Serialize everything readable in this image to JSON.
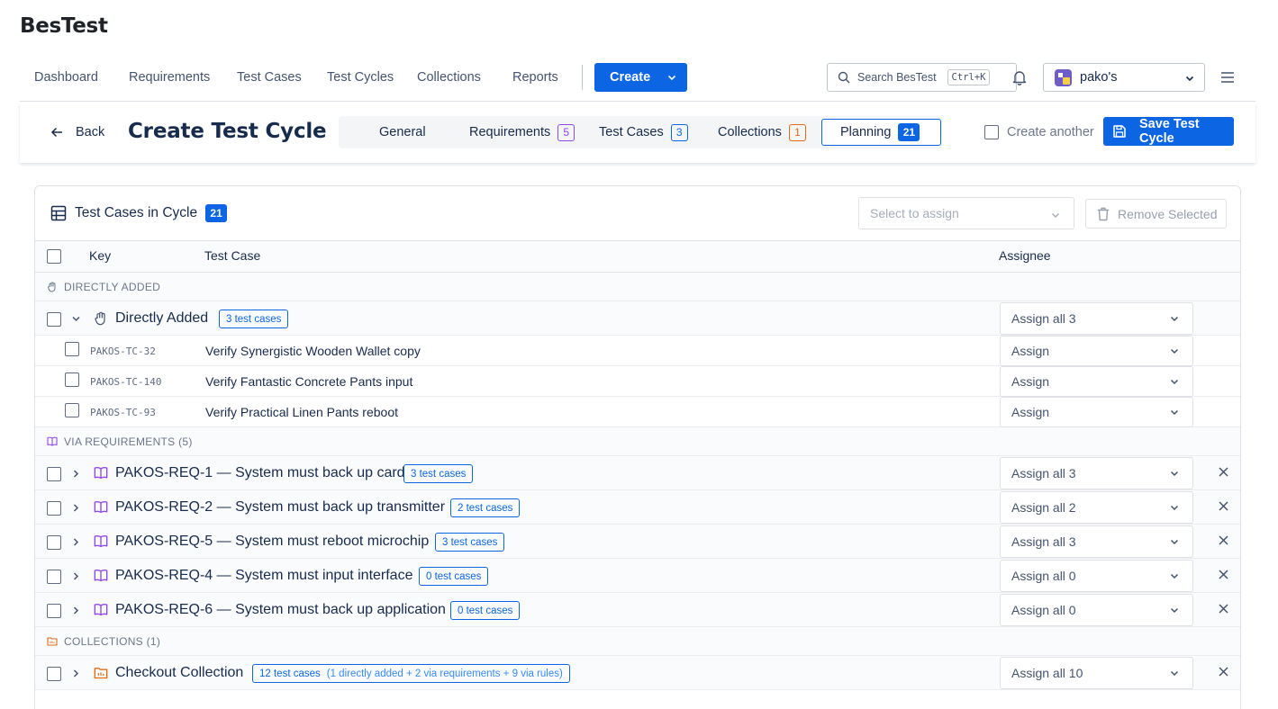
{
  "app": {
    "name": "BesTest"
  },
  "nav": {
    "items": [
      "Dashboard",
      "Requirements",
      "Test Cases",
      "Test Cycles",
      "Collections",
      "Reports"
    ],
    "create_label": "Create",
    "search_placeholder": "Search BesTest",
    "search_shortcut": "Ctrl+K",
    "workspace": "pako's"
  },
  "header": {
    "back_label": "Back",
    "title": "Create Test Cycle",
    "tabs": [
      {
        "label": "General"
      },
      {
        "label": "Requirements",
        "count": "5"
      },
      {
        "label": "Test Cases",
        "count": "3"
      },
      {
        "label": "Collections",
        "count": "1"
      },
      {
        "label": "Planning",
        "count": "21"
      }
    ],
    "create_another_label": "Create another",
    "save_label": "Save Test Cycle"
  },
  "card": {
    "title": "Test Cases in Cycle",
    "count": "21",
    "select_placeholder": "Select to assign",
    "remove_label": "Remove Selected",
    "columns": {
      "key": "Key",
      "test_case": "Test Case",
      "assignee": "Assignee"
    }
  },
  "sections": {
    "direct": {
      "label": "DIRECTLY ADDED",
      "group": {
        "name": "Directly Added",
        "badge": "3 test cases",
        "assign": "Assign all 3"
      },
      "rows": [
        {
          "key": "PAKOS-TC-32",
          "name": "Verify Synergistic Wooden Wallet copy",
          "assign": "Assign"
        },
        {
          "key": "PAKOS-TC-140",
          "name": "Verify Fantastic Concrete Pants input",
          "assign": "Assign"
        },
        {
          "key": "PAKOS-TC-93",
          "name": "Verify Practical Linen Pants reboot",
          "assign": "Assign"
        }
      ]
    },
    "requirements": {
      "label": "VIA REQUIREMENTS (5)",
      "groups": [
        {
          "name": "PAKOS-REQ-1 — System must back up card",
          "badge": "3 test cases",
          "assign": "Assign all 3"
        },
        {
          "name": "PAKOS-REQ-2 — System must back up transmitter",
          "badge": "2 test cases",
          "assign": "Assign all 2"
        },
        {
          "name": "PAKOS-REQ-5 — System must reboot microchip",
          "badge": "3 test cases",
          "assign": "Assign all 3"
        },
        {
          "name": "PAKOS-REQ-4 — System must input interface",
          "badge": "0 test cases",
          "assign": "Assign all 0"
        },
        {
          "name": "PAKOS-REQ-6 — System must back up application",
          "badge": "0 test cases",
          "assign": "Assign all 0"
        }
      ]
    },
    "collections": {
      "label": "COLLECTIONS (1)",
      "groups": [
        {
          "name": "Checkout Collection",
          "badge": "12 test cases",
          "badge_extra": "(1 directly added + 2 via requirements + 9 via rules)",
          "assign": "Assign all 10"
        }
      ]
    }
  },
  "colors": {
    "primary": "#0c66e4",
    "requirements_purple": "#8f46ef",
    "collections_orange": "#e56910"
  }
}
